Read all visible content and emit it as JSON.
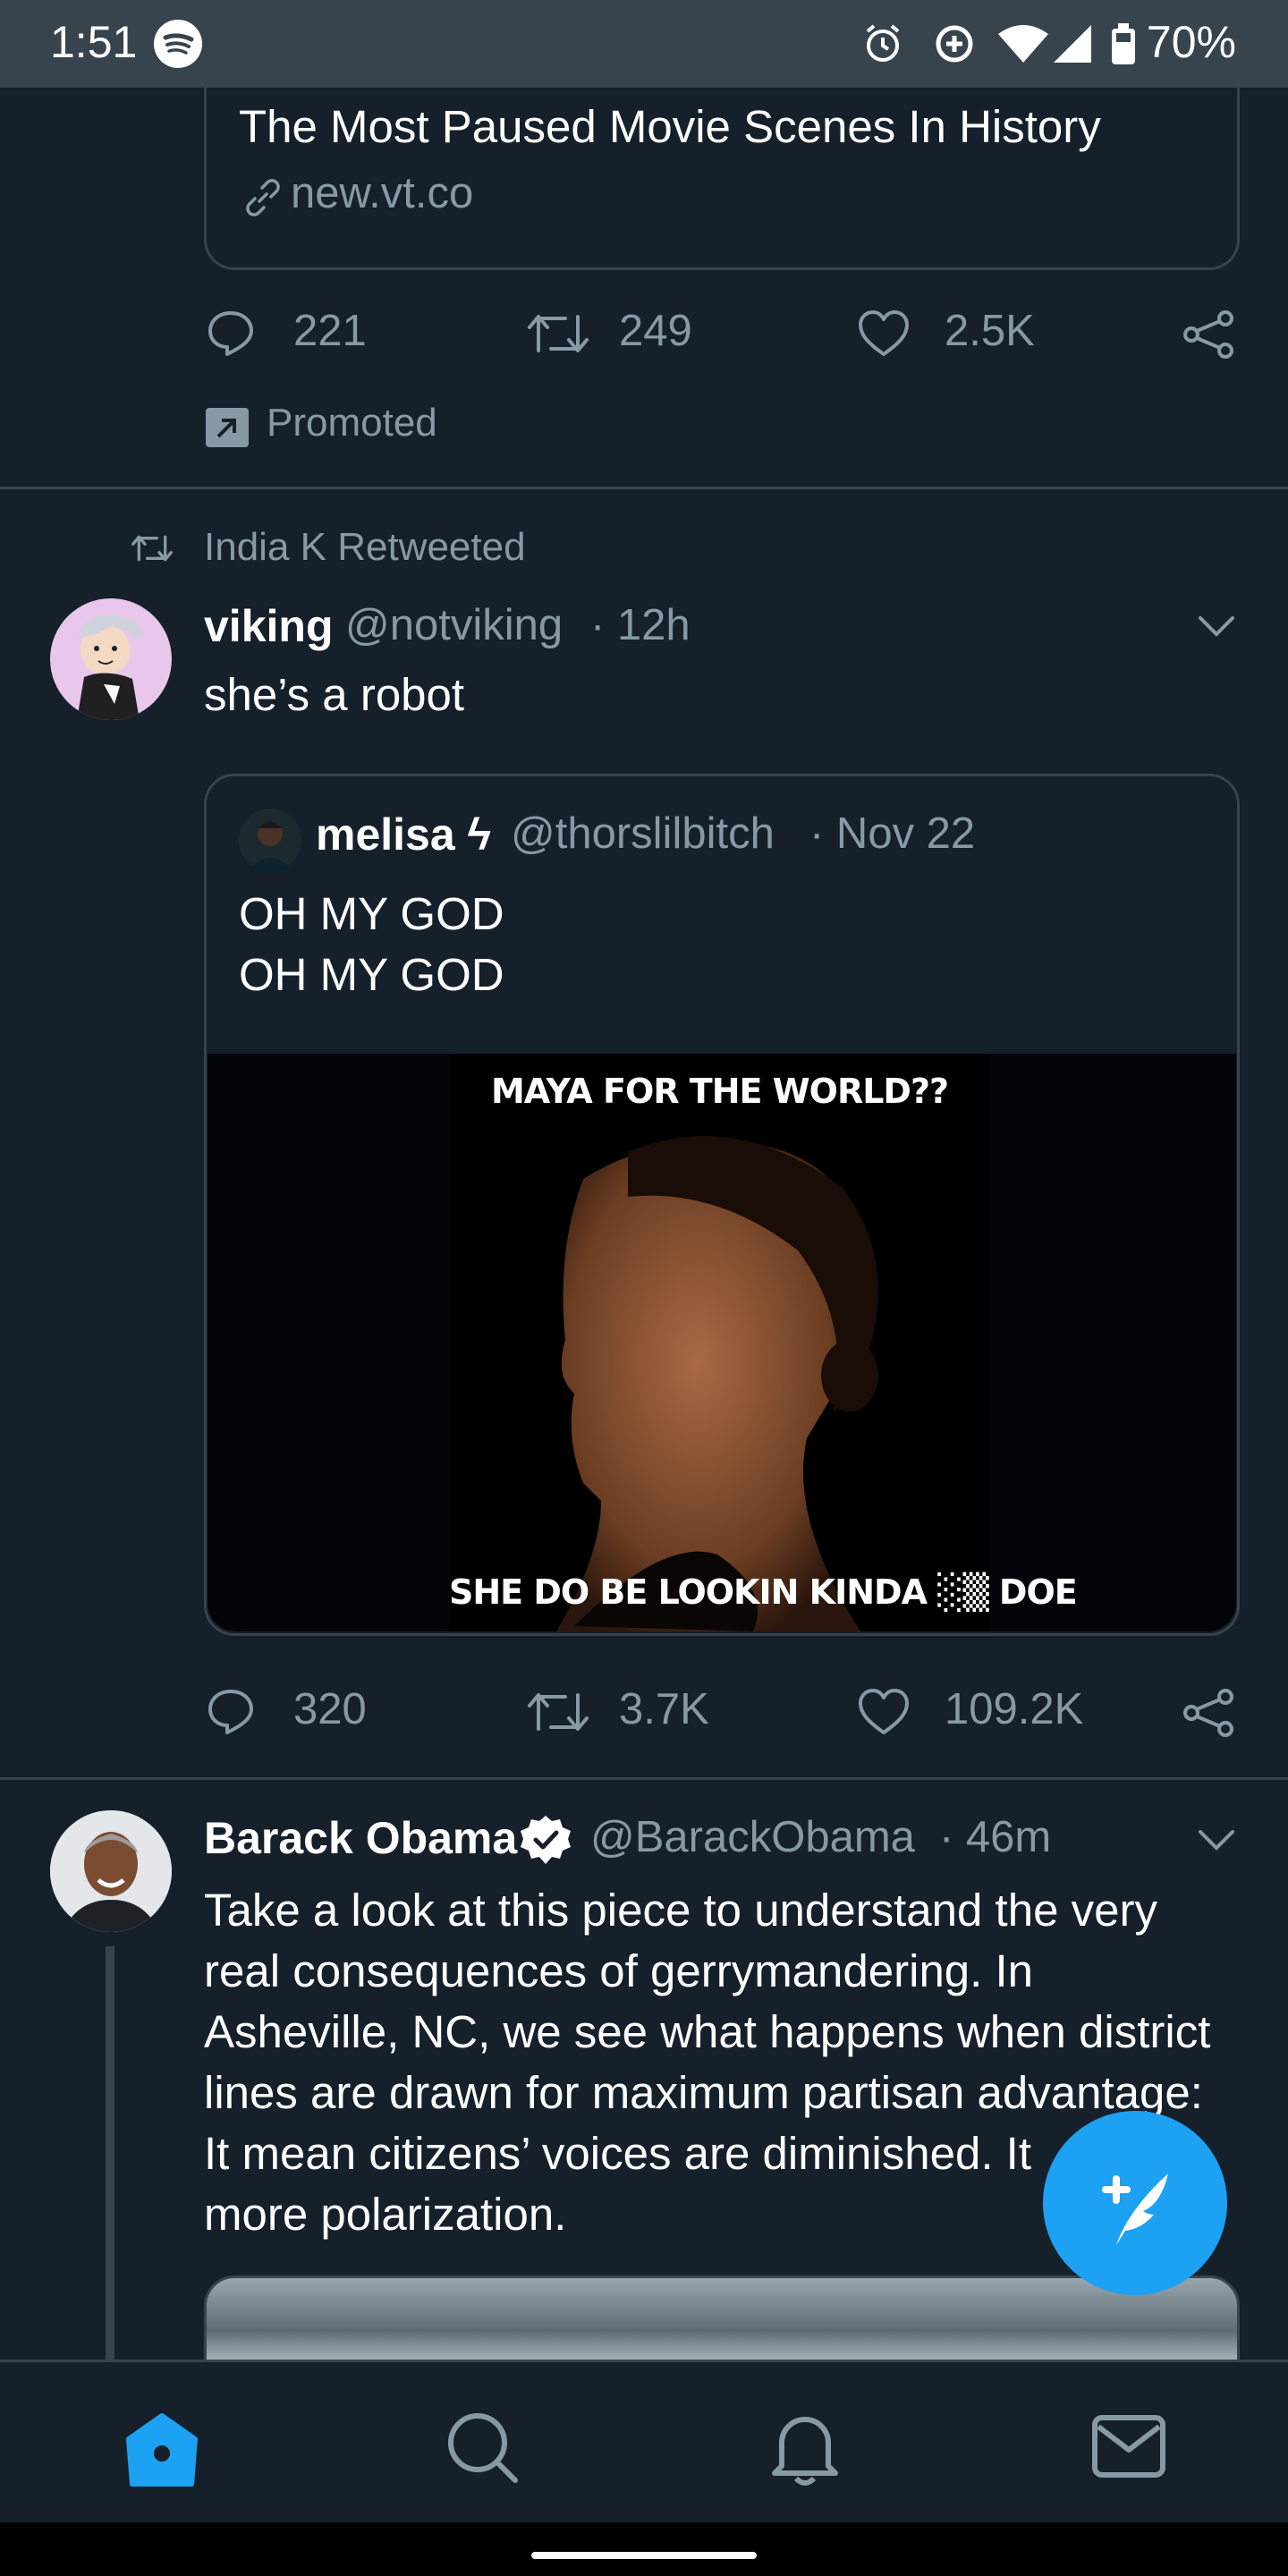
{
  "status_bar": {
    "time": "1:51",
    "battery": "70%",
    "icons": [
      "spotify-icon",
      "alarm-icon",
      "data-saver-icon",
      "wifi-icon",
      "cell-signal-icon",
      "battery-icon"
    ]
  },
  "promoted_tweet": {
    "link_title": "The Most Paused Movie Scenes In History",
    "link_domain": "new.vt.co",
    "reply_count": "221",
    "retweet_count": "249",
    "like_count": "2.5K",
    "promoted_label": "Promoted"
  },
  "retweet_tweet": {
    "retweeted_by": "India K Retweeted",
    "name": "viking",
    "handle": "@notviking",
    "time": "· 12h",
    "text": "she’s a robot",
    "quote": {
      "name": "melisa ϟ",
      "handle": "@thorslilbitch",
      "time": "· Nov 22",
      "line1": "OH MY GOD",
      "line2": "OH MY GOD",
      "media_caption_top": "MAYA FOR THE WORLD??",
      "media_caption_bottom": "SHE DO BE LOOKIN KINDA ░▒ DOE"
    },
    "reply_count": "320",
    "retweet_count": "3.7K",
    "like_count": "109.2K"
  },
  "obama_tweet": {
    "name": "Barack Obama",
    "handle": "@BarackObama",
    "time": "· 46m",
    "lines": [
      "Take a look at this piece to understand the very",
      "real consequences of gerrymandering. In",
      "Asheville, NC, we see what happens when district",
      "lines are drawn for maximum partisan advantage:",
      "It mean citizens’ voices are diminished. It",
      "more polarization."
    ]
  },
  "bottom_nav": {
    "items": [
      "home-icon",
      "search-icon",
      "notifications-icon",
      "messages-icon"
    ]
  },
  "colors": {
    "background": "#15202b",
    "divider": "#38444d",
    "muted": "#8899a6",
    "accent": "#1da1f2"
  }
}
